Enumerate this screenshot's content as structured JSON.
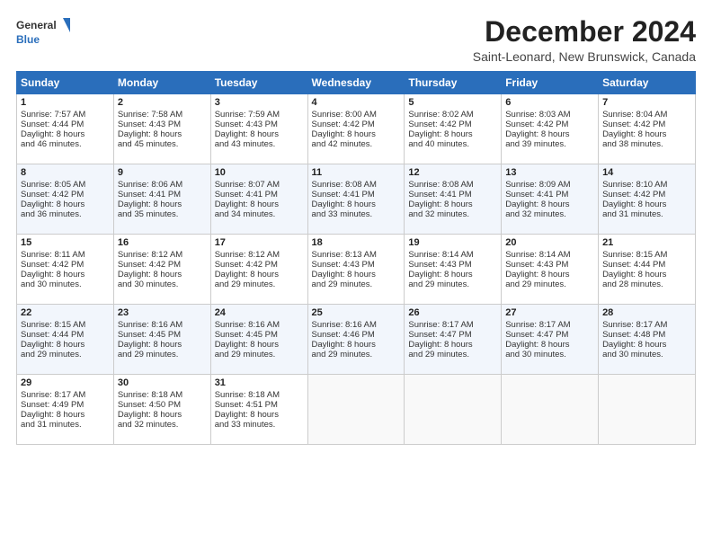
{
  "logo": {
    "line1": "General",
    "line2": "Blue"
  },
  "title": "December 2024",
  "subtitle": "Saint-Leonard, New Brunswick, Canada",
  "header_days": [
    "Sunday",
    "Monday",
    "Tuesday",
    "Wednesday",
    "Thursday",
    "Friday",
    "Saturday"
  ],
  "weeks": [
    [
      {
        "day": "1",
        "lines": [
          "Sunrise: 7:57 AM",
          "Sunset: 4:44 PM",
          "Daylight: 8 hours",
          "and 46 minutes."
        ]
      },
      {
        "day": "2",
        "lines": [
          "Sunrise: 7:58 AM",
          "Sunset: 4:43 PM",
          "Daylight: 8 hours",
          "and 45 minutes."
        ]
      },
      {
        "day": "3",
        "lines": [
          "Sunrise: 7:59 AM",
          "Sunset: 4:43 PM",
          "Daylight: 8 hours",
          "and 43 minutes."
        ]
      },
      {
        "day": "4",
        "lines": [
          "Sunrise: 8:00 AM",
          "Sunset: 4:42 PM",
          "Daylight: 8 hours",
          "and 42 minutes."
        ]
      },
      {
        "day": "5",
        "lines": [
          "Sunrise: 8:02 AM",
          "Sunset: 4:42 PM",
          "Daylight: 8 hours",
          "and 40 minutes."
        ]
      },
      {
        "day": "6",
        "lines": [
          "Sunrise: 8:03 AM",
          "Sunset: 4:42 PM",
          "Daylight: 8 hours",
          "and 39 minutes."
        ]
      },
      {
        "day": "7",
        "lines": [
          "Sunrise: 8:04 AM",
          "Sunset: 4:42 PM",
          "Daylight: 8 hours",
          "and 38 minutes."
        ]
      }
    ],
    [
      {
        "day": "8",
        "lines": [
          "Sunrise: 8:05 AM",
          "Sunset: 4:42 PM",
          "Daylight: 8 hours",
          "and 36 minutes."
        ]
      },
      {
        "day": "9",
        "lines": [
          "Sunrise: 8:06 AM",
          "Sunset: 4:41 PM",
          "Daylight: 8 hours",
          "and 35 minutes."
        ]
      },
      {
        "day": "10",
        "lines": [
          "Sunrise: 8:07 AM",
          "Sunset: 4:41 PM",
          "Daylight: 8 hours",
          "and 34 minutes."
        ]
      },
      {
        "day": "11",
        "lines": [
          "Sunrise: 8:08 AM",
          "Sunset: 4:41 PM",
          "Daylight: 8 hours",
          "and 33 minutes."
        ]
      },
      {
        "day": "12",
        "lines": [
          "Sunrise: 8:08 AM",
          "Sunset: 4:41 PM",
          "Daylight: 8 hours",
          "and 32 minutes."
        ]
      },
      {
        "day": "13",
        "lines": [
          "Sunrise: 8:09 AM",
          "Sunset: 4:41 PM",
          "Daylight: 8 hours",
          "and 32 minutes."
        ]
      },
      {
        "day": "14",
        "lines": [
          "Sunrise: 8:10 AM",
          "Sunset: 4:42 PM",
          "Daylight: 8 hours",
          "and 31 minutes."
        ]
      }
    ],
    [
      {
        "day": "15",
        "lines": [
          "Sunrise: 8:11 AM",
          "Sunset: 4:42 PM",
          "Daylight: 8 hours",
          "and 30 minutes."
        ]
      },
      {
        "day": "16",
        "lines": [
          "Sunrise: 8:12 AM",
          "Sunset: 4:42 PM",
          "Daylight: 8 hours",
          "and 30 minutes."
        ]
      },
      {
        "day": "17",
        "lines": [
          "Sunrise: 8:12 AM",
          "Sunset: 4:42 PM",
          "Daylight: 8 hours",
          "and 29 minutes."
        ]
      },
      {
        "day": "18",
        "lines": [
          "Sunrise: 8:13 AM",
          "Sunset: 4:43 PM",
          "Daylight: 8 hours",
          "and 29 minutes."
        ]
      },
      {
        "day": "19",
        "lines": [
          "Sunrise: 8:14 AM",
          "Sunset: 4:43 PM",
          "Daylight: 8 hours",
          "and 29 minutes."
        ]
      },
      {
        "day": "20",
        "lines": [
          "Sunrise: 8:14 AM",
          "Sunset: 4:43 PM",
          "Daylight: 8 hours",
          "and 29 minutes."
        ]
      },
      {
        "day": "21",
        "lines": [
          "Sunrise: 8:15 AM",
          "Sunset: 4:44 PM",
          "Daylight: 8 hours",
          "and 28 minutes."
        ]
      }
    ],
    [
      {
        "day": "22",
        "lines": [
          "Sunrise: 8:15 AM",
          "Sunset: 4:44 PM",
          "Daylight: 8 hours",
          "and 29 minutes."
        ]
      },
      {
        "day": "23",
        "lines": [
          "Sunrise: 8:16 AM",
          "Sunset: 4:45 PM",
          "Daylight: 8 hours",
          "and 29 minutes."
        ]
      },
      {
        "day": "24",
        "lines": [
          "Sunrise: 8:16 AM",
          "Sunset: 4:45 PM",
          "Daylight: 8 hours",
          "and 29 minutes."
        ]
      },
      {
        "day": "25",
        "lines": [
          "Sunrise: 8:16 AM",
          "Sunset: 4:46 PM",
          "Daylight: 8 hours",
          "and 29 minutes."
        ]
      },
      {
        "day": "26",
        "lines": [
          "Sunrise: 8:17 AM",
          "Sunset: 4:47 PM",
          "Daylight: 8 hours",
          "and 29 minutes."
        ]
      },
      {
        "day": "27",
        "lines": [
          "Sunrise: 8:17 AM",
          "Sunset: 4:47 PM",
          "Daylight: 8 hours",
          "and 30 minutes."
        ]
      },
      {
        "day": "28",
        "lines": [
          "Sunrise: 8:17 AM",
          "Sunset: 4:48 PM",
          "Daylight: 8 hours",
          "and 30 minutes."
        ]
      }
    ],
    [
      {
        "day": "29",
        "lines": [
          "Sunrise: 8:17 AM",
          "Sunset: 4:49 PM",
          "Daylight: 8 hours",
          "and 31 minutes."
        ]
      },
      {
        "day": "30",
        "lines": [
          "Sunrise: 8:18 AM",
          "Sunset: 4:50 PM",
          "Daylight: 8 hours",
          "and 32 minutes."
        ]
      },
      {
        "day": "31",
        "lines": [
          "Sunrise: 8:18 AM",
          "Sunset: 4:51 PM",
          "Daylight: 8 hours",
          "and 33 minutes."
        ]
      },
      {
        "day": "",
        "lines": []
      },
      {
        "day": "",
        "lines": []
      },
      {
        "day": "",
        "lines": []
      },
      {
        "day": "",
        "lines": []
      }
    ]
  ]
}
